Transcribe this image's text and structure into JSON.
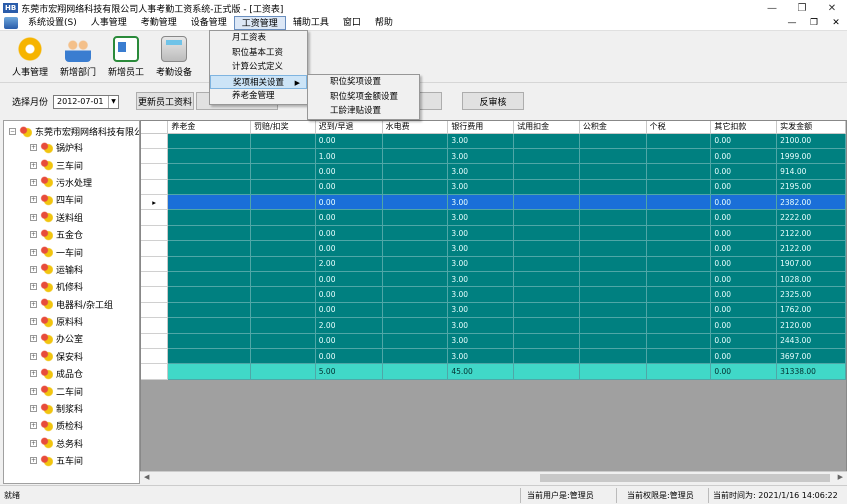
{
  "window": {
    "logo": "HB",
    "title": "东莞市宏翔网络科技有限公司人事考勤工资系统-正式版 - [工资表]",
    "min": "—",
    "restore": "❐",
    "close": "✕"
  },
  "menubar": {
    "items": [
      "系统设置(S)",
      "人事管理",
      "考勤管理",
      "设备管理",
      "工资管理",
      "辅助工具",
      "窗口",
      "帮助"
    ],
    "right": [
      "—",
      "❐",
      "✕"
    ]
  },
  "toolbar": {
    "items": [
      "人事管理",
      "新增部门",
      "新增员工",
      "考勤设备"
    ]
  },
  "filter": {
    "label": "选择月份",
    "date": "2012-07-01",
    "update_button": "更新员工资料",
    "review_button": "反审核"
  },
  "dropdown_menu": {
    "items": [
      "月工资表",
      "职位基本工资",
      "计算公式定义",
      "奖项相关设置",
      "养老金管理"
    ]
  },
  "submenu": {
    "items": [
      "职位奖项设置",
      "职位奖项金额设置",
      "工龄津贴设置"
    ]
  },
  "tree": {
    "root": "东莞市宏翔网络科技有限公司",
    "nodes": [
      "锅炉科",
      "三车间",
      "污水处理",
      "四车间",
      "送料组",
      "五金仓",
      "一车间",
      "运输科",
      "机修科",
      "电器科/杂工组",
      "原料科",
      "办公室",
      "保安科",
      "成品仓",
      "二车间",
      "制浆科",
      "质检科",
      "总务科",
      "五车间"
    ]
  },
  "grid": {
    "columns": [
      "",
      "养老金",
      "罚赔/扣奖",
      "迟到/早退",
      "水电费",
      "银行费用",
      "试用扣金",
      "公积金",
      "个税",
      "其它扣款",
      "实发金额"
    ],
    "rows": [
      [
        "",
        "",
        "",
        "0.00",
        "",
        "3.00",
        "",
        "",
        "",
        "0.00",
        "2100.00"
      ],
      [
        "",
        "",
        "",
        "1.00",
        "",
        "3.00",
        "",
        "",
        "",
        "0.00",
        "1999.00"
      ],
      [
        "",
        "",
        "",
        "0.00",
        "",
        "3.00",
        "",
        "",
        "",
        "0.00",
        "914.00"
      ],
      [
        "",
        "",
        "",
        "0.00",
        "",
        "3.00",
        "",
        "",
        "",
        "0.00",
        "2195.00"
      ],
      [
        "▸",
        "",
        "",
        "0.00",
        "",
        "3.00",
        "",
        "",
        "",
        "0.00",
        "2382.00"
      ],
      [
        "",
        "",
        "",
        "0.00",
        "",
        "3.00",
        "",
        "",
        "",
        "0.00",
        "2222.00"
      ],
      [
        "",
        "",
        "",
        "0.00",
        "",
        "3.00",
        "",
        "",
        "",
        "0.00",
        "2122.00"
      ],
      [
        "",
        "",
        "",
        "0.00",
        "",
        "3.00",
        "",
        "",
        "",
        "0.00",
        "2122.00"
      ],
      [
        "",
        "",
        "",
        "2.00",
        "",
        "3.00",
        "",
        "",
        "",
        "0.00",
        "1907.00"
      ],
      [
        "",
        "",
        "",
        "0.00",
        "",
        "3.00",
        "",
        "",
        "",
        "0.00",
        "1028.00"
      ],
      [
        "",
        "",
        "",
        "0.00",
        "",
        "3.00",
        "",
        "",
        "",
        "0.00",
        "2325.00"
      ],
      [
        "",
        "",
        "",
        "0.00",
        "",
        "3.00",
        "",
        "",
        "",
        "0.00",
        "1762.00"
      ],
      [
        "",
        "",
        "",
        "2.00",
        "",
        "3.00",
        "",
        "",
        "",
        "0.00",
        "2120.00"
      ],
      [
        "",
        "",
        "",
        "0.00",
        "",
        "3.00",
        "",
        "",
        "",
        "0.00",
        "2443.00"
      ],
      [
        "",
        "",
        "",
        "0.00",
        "",
        "3.00",
        "",
        "",
        "",
        "0.00",
        "3697.00"
      ]
    ],
    "total": [
      "",
      "",
      "",
      "5.00",
      "",
      "45.00",
      "",
      "",
      "",
      "0.00",
      "31338.00"
    ],
    "selected_row": 4
  },
  "status": {
    "ready": "就绪",
    "user": "当前用户是:管理员",
    "permission": "当前权限是:管理员",
    "time": "当前时间为: 2021/1/16 14:06:22"
  }
}
